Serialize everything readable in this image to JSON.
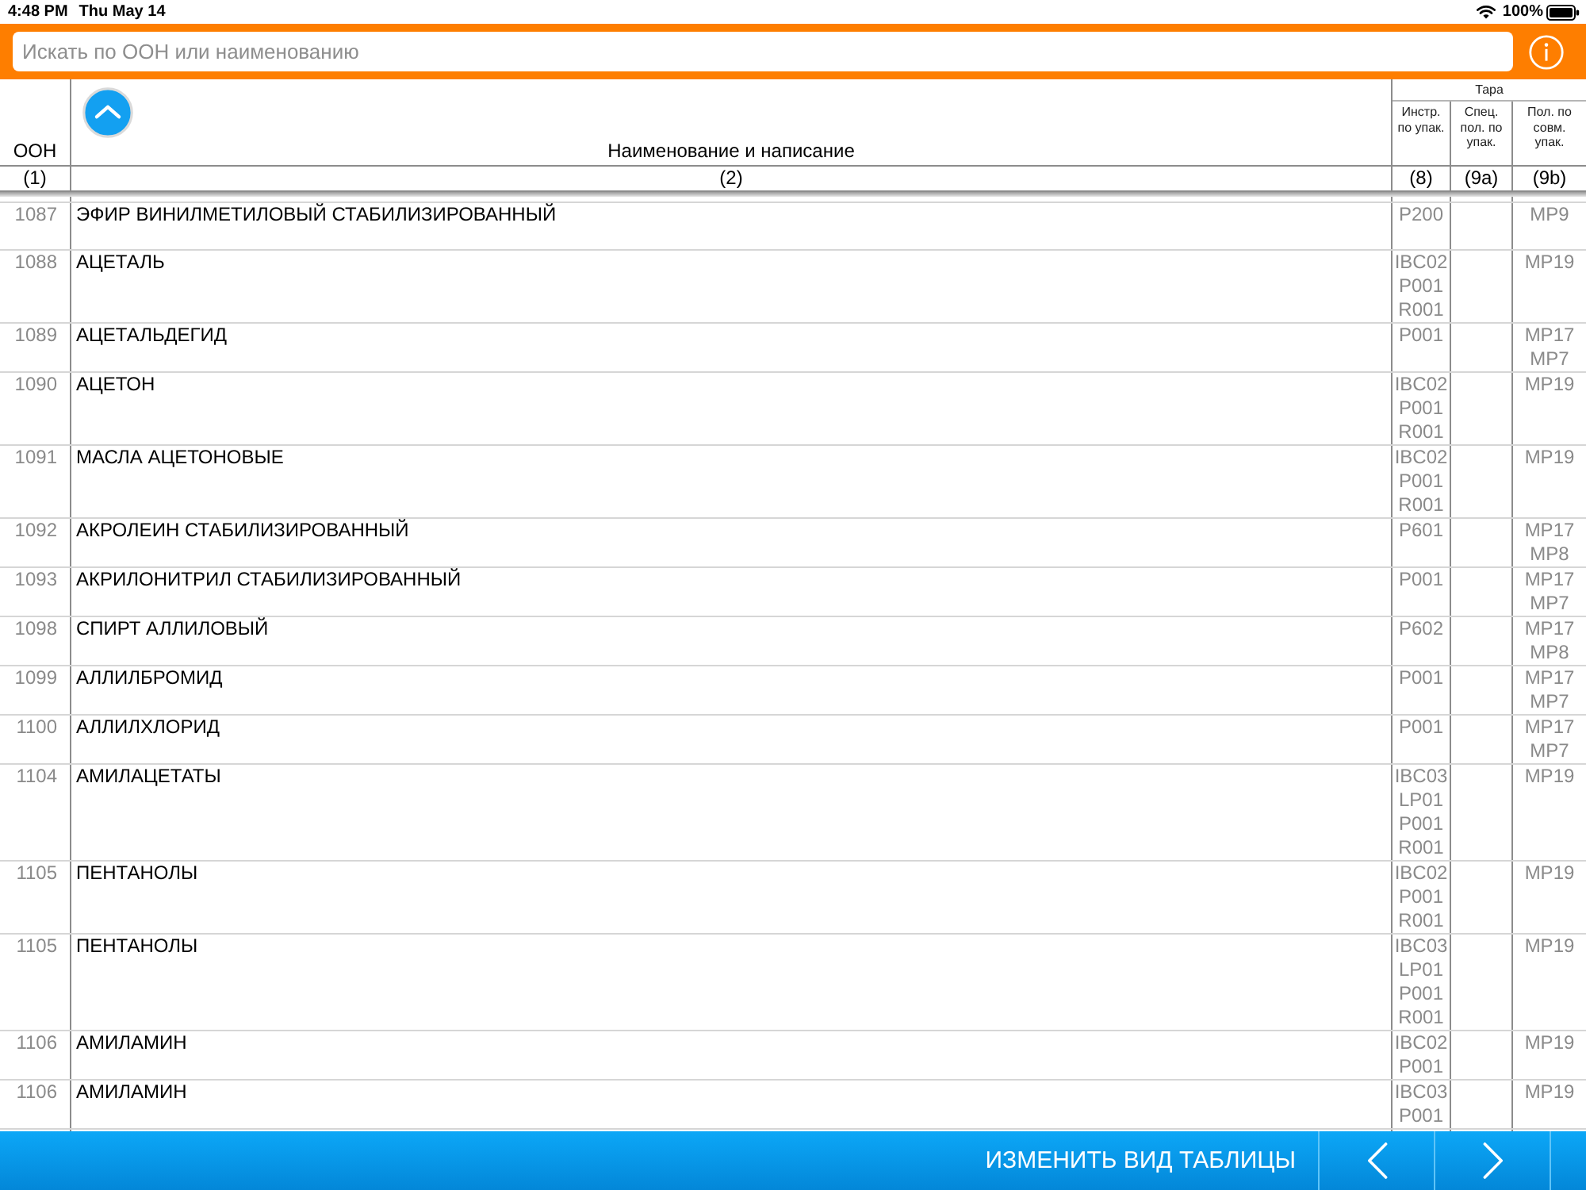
{
  "status_bar": {
    "time": "4:48 PM",
    "date": "Thu May 14",
    "battery": "100%"
  },
  "search": {
    "placeholder": "Искать по ООН или наименованию"
  },
  "table": {
    "columns": [
      {
        "label": "ООН",
        "number": "(1)"
      },
      {
        "label": "Наименование и написание",
        "number": "(2)"
      }
    ],
    "column_group": {
      "label": "Тара",
      "columns": [
        {
          "label": "Инстр. по упак.",
          "number": "(8)"
        },
        {
          "label": "Спец. пол. по упак.",
          "number": "(9a)"
        },
        {
          "label": "Пол. по совм. упак.",
          "number": "(9b)"
        }
      ]
    },
    "rows": [
      {
        "un": "1087",
        "name": "ЭФИР ВИНИЛМЕТИЛОВЫЙ СТАБИЛИЗИРОВАННЫЙ",
        "packing": [
          "P200"
        ],
        "mixed_packing": [
          "MP9"
        ]
      },
      {
        "un": "1088",
        "name": "АЦЕТАЛЬ",
        "packing": [
          "IBC02",
          "P001",
          "R001"
        ],
        "mixed_packing": [
          "MP19"
        ]
      },
      {
        "un": "1089",
        "name": "АЦЕТАЛЬДЕГИД",
        "packing": [
          "P001"
        ],
        "mixed_packing": [
          "MP17",
          "MP7"
        ]
      },
      {
        "un": "1090",
        "name": "АЦЕТОН",
        "packing": [
          "IBC02",
          "P001",
          "R001"
        ],
        "mixed_packing": [
          "MP19"
        ]
      },
      {
        "un": "1091",
        "name": "МАСЛА АЦЕТОНОВЫЕ",
        "packing": [
          "IBC02",
          "P001",
          "R001"
        ],
        "mixed_packing": [
          "MP19"
        ]
      },
      {
        "un": "1092",
        "name": "АКРОЛЕИН СТАБИЛИЗИРОВАННЫЙ",
        "packing": [
          "P601"
        ],
        "mixed_packing": [
          "MP17",
          "MP8"
        ]
      },
      {
        "un": "1093",
        "name": "АКРИЛОНИТРИЛ СТАБИЛИЗИРОВАННЫЙ",
        "packing": [
          "P001"
        ],
        "mixed_packing": [
          "MP17",
          "MP7"
        ]
      },
      {
        "un": "1098",
        "name": "СПИРТ АЛЛИЛОВЫЙ",
        "packing": [
          "P602"
        ],
        "mixed_packing": [
          "MP17",
          "MP8"
        ]
      },
      {
        "un": "1099",
        "name": "АЛЛИЛБРОМИД",
        "packing": [
          "P001"
        ],
        "mixed_packing": [
          "MP17",
          "MP7"
        ]
      },
      {
        "un": "1100",
        "name": "АЛЛИЛХЛОРИД",
        "packing": [
          "P001"
        ],
        "mixed_packing": [
          "MP17",
          "MP7"
        ]
      },
      {
        "un": "1104",
        "name": "АМИЛАЦЕТАТЫ",
        "packing": [
          "IBC03",
          "LP01",
          "P001",
          "R001"
        ],
        "mixed_packing": [
          "MP19"
        ]
      },
      {
        "un": "1105",
        "name": "ПЕНТАНОЛЫ",
        "packing": [
          "IBC02",
          "P001",
          "R001"
        ],
        "mixed_packing": [
          "MP19"
        ]
      },
      {
        "un": "1105",
        "name": "ПЕНТАНОЛЫ",
        "packing": [
          "IBC03",
          "LP01",
          "P001",
          "R001"
        ],
        "mixed_packing": [
          "MP19"
        ]
      },
      {
        "un": "1106",
        "name": "АМИЛАМИН",
        "packing": [
          "IBC02",
          "P001"
        ],
        "mixed_packing": [
          "MP19"
        ]
      },
      {
        "un": "1106",
        "name": "АМИЛАМИН",
        "packing": [
          "IBC03",
          "P001"
        ],
        "mixed_packing": [
          "MP19"
        ]
      }
    ]
  },
  "bottom_bar": {
    "buttons": [
      {
        "kind": "text",
        "label": "ИЗМЕНИТЬ ВИД ТАБЛИЦЫ"
      },
      {
        "kind": "previous"
      },
      {
        "kind": "next"
      }
    ]
  }
}
